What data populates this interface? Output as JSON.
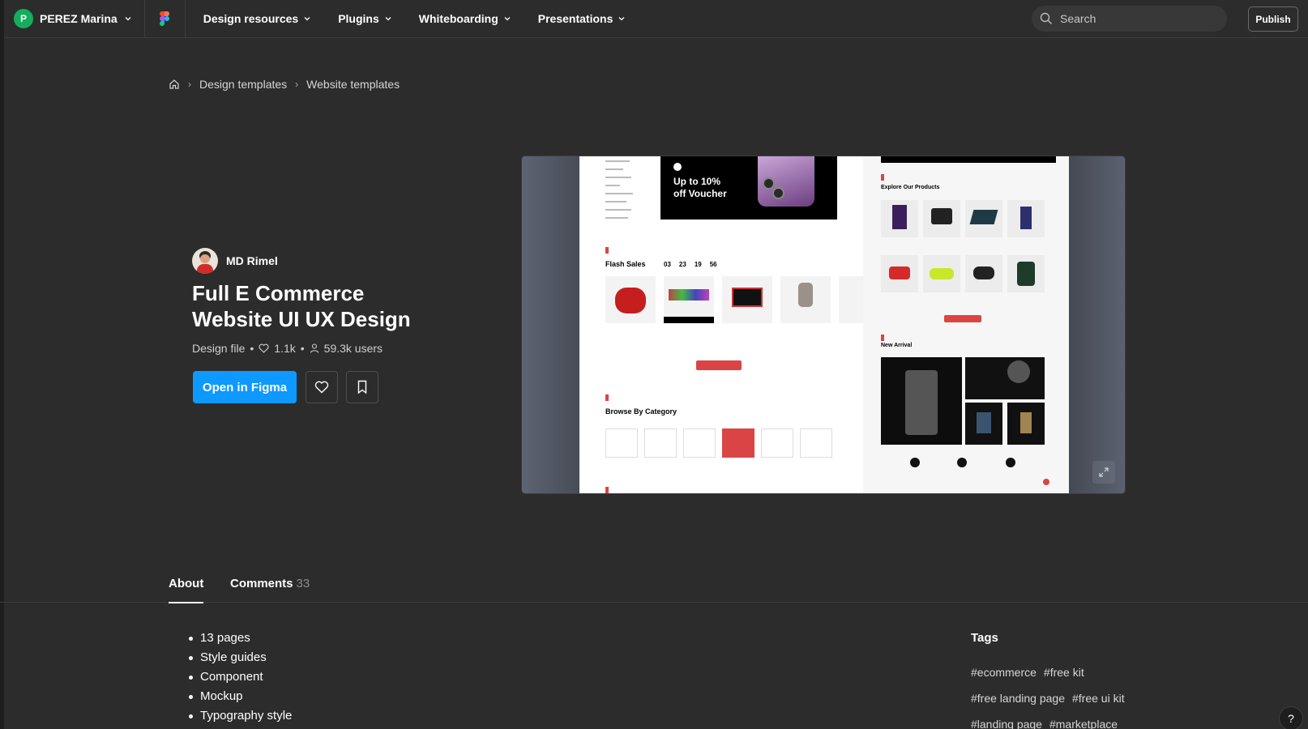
{
  "account": {
    "initial": "P",
    "name": "PEREZ Marina"
  },
  "nav": {
    "items": [
      {
        "label": "Design resources"
      },
      {
        "label": "Plugins"
      },
      {
        "label": "Whiteboarding"
      },
      {
        "label": "Presentations"
      }
    ],
    "search_placeholder": "Search",
    "publish_label": "Publish"
  },
  "breadcrumb": {
    "items": [
      "Design templates",
      "Website templates"
    ]
  },
  "file": {
    "author": "MD Rimel",
    "title": "Full E Commerce Website UI UX Design",
    "type": "Design file",
    "likes": "1.1k",
    "users": "59.3k users",
    "open_label": "Open in Figma"
  },
  "preview": {
    "voucher_line1": "Up to 10%",
    "voucher_line2": "off Voucher",
    "flash_sales": "Flash Sales",
    "timer": [
      "03",
      "23",
      "19",
      "56"
    ],
    "browse_category": "Browse By Category",
    "explore_products": "Explore Our Products",
    "new_arrival": "New Arrival"
  },
  "tabs": [
    {
      "label": "About",
      "count": ""
    },
    {
      "label": "Comments",
      "count": "33"
    }
  ],
  "about": {
    "items": [
      "13 pages",
      "Style guides",
      "Component",
      "Mockup",
      "Typography style"
    ]
  },
  "tags": {
    "title": "Tags",
    "items": [
      "#ecommerce",
      "#free kit",
      "#free landing page",
      "#free ui kit",
      "#landing page",
      "#marketplace"
    ]
  },
  "help_label": "?",
  "colors": {
    "accent": "#0d99ff",
    "preview_red": "#db4444",
    "avatar_green": "#14ae5c"
  }
}
